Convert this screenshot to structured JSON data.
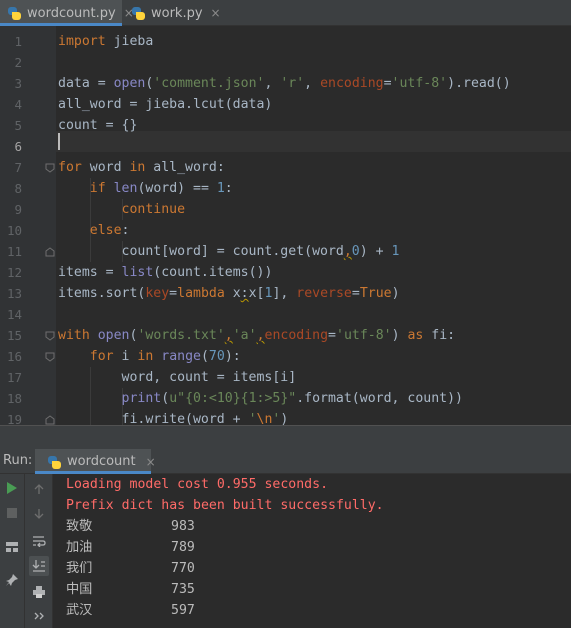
{
  "editor_tabs": [
    {
      "label": "wordcount.py",
      "close": "×"
    },
    {
      "label": "work.py",
      "close": "×"
    }
  ],
  "editor": {
    "line_numbers": [
      "1",
      "2",
      "3",
      "4",
      "5",
      "6",
      "7",
      "8",
      "9",
      "10",
      "11",
      "12",
      "13",
      "14",
      "15",
      "16",
      "17",
      "18",
      "19"
    ],
    "current_line": 6,
    "lines": [
      [
        {
          "t": "import",
          "c": "kw"
        },
        {
          "t": " jieba"
        }
      ],
      [],
      [
        {
          "t": "data = "
        },
        {
          "t": "open",
          "c": "fn"
        },
        {
          "t": "("
        },
        {
          "t": "'comment.json'",
          "c": "str"
        },
        {
          "t": ", "
        },
        {
          "t": "'r'",
          "c": "str"
        },
        {
          "t": ", "
        },
        {
          "t": "encoding",
          "c": "prm"
        },
        {
          "t": "="
        },
        {
          "t": "'utf-8'",
          "c": "str"
        },
        {
          "t": ").read()"
        }
      ],
      [
        {
          "t": "all_word = jieba.lcut(data)"
        }
      ],
      [
        {
          "t": "count = {}"
        }
      ],
      [],
      [
        {
          "t": "for",
          "c": "kw"
        },
        {
          "t": " word "
        },
        {
          "t": "in",
          "c": "kw"
        },
        {
          "t": " all_word:"
        }
      ],
      [
        {
          "t": "    "
        },
        {
          "t": "if",
          "c": "kw"
        },
        {
          "t": " "
        },
        {
          "t": "len",
          "c": "fn"
        },
        {
          "t": "(word) == "
        },
        {
          "t": "1",
          "c": "num"
        },
        {
          "t": ":"
        }
      ],
      [
        {
          "t": "        "
        },
        {
          "t": "continue",
          "c": "kw"
        }
      ],
      [
        {
          "t": "    "
        },
        {
          "t": "else",
          "c": "kw"
        },
        {
          "t": ":"
        }
      ],
      [
        {
          "t": "        count[word] = count.get(word"
        },
        {
          "t": ",",
          "c": "warnc"
        },
        {
          "t": "0",
          "c": "num"
        },
        {
          "t": ") + "
        },
        {
          "t": "1",
          "c": "num"
        }
      ],
      [
        {
          "t": "items = "
        },
        {
          "t": "list",
          "c": "fn"
        },
        {
          "t": "(count.items())"
        }
      ],
      [
        {
          "t": "items.sort("
        },
        {
          "t": "key",
          "c": "prm"
        },
        {
          "t": "="
        },
        {
          "t": "lambda",
          "c": "kw"
        },
        {
          "t": " x"
        },
        {
          "t": ":",
          "c": "uw"
        },
        {
          "t": "x["
        },
        {
          "t": "1",
          "c": "num"
        },
        {
          "t": "], "
        },
        {
          "t": "reverse",
          "c": "prm"
        },
        {
          "t": "="
        },
        {
          "t": "True",
          "c": "kw"
        },
        {
          "t": ")"
        }
      ],
      [],
      [
        {
          "t": "with",
          "c": "kw"
        },
        {
          "t": " "
        },
        {
          "t": "open",
          "c": "fn"
        },
        {
          "t": "("
        },
        {
          "t": "'words.txt'",
          "c": "str"
        },
        {
          "t": ",",
          "c": "warnc"
        },
        {
          "t": "'a'",
          "c": "str"
        },
        {
          "t": ",",
          "c": "warnc"
        },
        {
          "t": "encoding",
          "c": "prm"
        },
        {
          "t": "="
        },
        {
          "t": "'utf-8'",
          "c": "str"
        },
        {
          "t": ") "
        },
        {
          "t": "as",
          "c": "kw"
        },
        {
          "t": " fi:"
        }
      ],
      [
        {
          "t": "    "
        },
        {
          "t": "for",
          "c": "kw"
        },
        {
          "t": " i "
        },
        {
          "t": "in",
          "c": "kw"
        },
        {
          "t": " "
        },
        {
          "t": "range",
          "c": "fn"
        },
        {
          "t": "("
        },
        {
          "t": "70",
          "c": "num"
        },
        {
          "t": "):"
        }
      ],
      [
        {
          "t": "        word, count = items[i]"
        }
      ],
      [
        {
          "t": "        "
        },
        {
          "t": "print",
          "c": "fn"
        },
        {
          "t": "("
        },
        {
          "t": "u\"{0:<10}{1:>5}\"",
          "c": "str"
        },
        {
          "t": ".format(word, count))"
        }
      ],
      [
        {
          "t": "        fi.write(word + "
        },
        {
          "t": "'",
          "c": "str"
        },
        {
          "t": "\\n",
          "c": "kw"
        },
        {
          "t": "'",
          "c": "str"
        },
        {
          "t": ")"
        }
      ]
    ]
  },
  "run_panel": {
    "label": "Run:",
    "tab_label": "wordcount",
    "tab_close": "×",
    "console": {
      "messages": [
        "Loading model cost 0.955 seconds.",
        "Prefix dict has been built successfully."
      ],
      "rows": [
        {
          "word": "致敬",
          "count": "983"
        },
        {
          "word": "加油",
          "count": "789"
        },
        {
          "word": "我们",
          "count": "770"
        },
        {
          "word": "中国",
          "count": "735"
        },
        {
          "word": "武汉",
          "count": "597"
        }
      ]
    }
  },
  "icons": {
    "file_tab_icon": "python-file-icon",
    "run_tab_icon": "python-run-icon",
    "left_toolbar": [
      "rerun-icon",
      "stop-icon",
      "layout-icon",
      "pin-icon"
    ],
    "console_toolbar": [
      "up-arrow-icon",
      "down-arrow-icon",
      "soft-wrap-icon",
      "scroll-to-end-icon",
      "print-icon",
      "more-icon"
    ]
  },
  "colors": {
    "keyword": "#cc7832",
    "string": "#6a8759",
    "number": "#6897bb",
    "builtin": "#8888c6",
    "param": "#aa4926",
    "console_error": "#ff6b68",
    "accent": "#4a88c7"
  }
}
